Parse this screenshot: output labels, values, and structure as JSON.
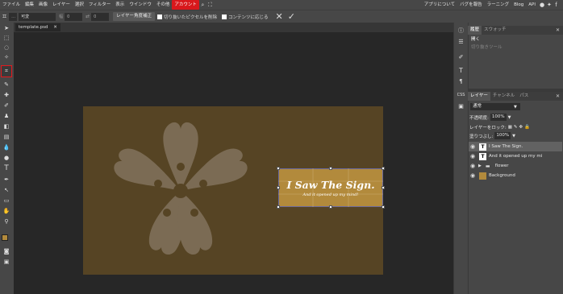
{
  "menu": {
    "items": [
      "ファイル",
      "編集",
      "画像",
      "レイヤー",
      "選択",
      "フィルター",
      "表示",
      "ウインドウ",
      "その他",
      "アカウント"
    ],
    "active": "アカウント",
    "right": [
      "アプリについて",
      "バグを報告",
      "ラーニング",
      "Blog",
      "API"
    ],
    "icons": [
      "search-icon",
      "fullscreen-icon",
      "reddit-icon",
      "twitter-icon",
      "facebook-icon"
    ]
  },
  "options": {
    "mode_value": "可変",
    "width_label": "幅",
    "width_value": "0",
    "height_value": "0",
    "layer_ratio_button": "レイヤー角度補正",
    "delete_cropped_label": "切り抜いたピクセルを削除",
    "fit_content_label": "コンテンツに応じる",
    "cancel_symbol": "✕",
    "confirm_symbol": "✓"
  },
  "document": {
    "tab_name": "template.psd",
    "tab_close": "✕",
    "title_text": "I Saw The Sign.",
    "subtitle_text": "And it opened up my mind!",
    "canvas_color": "#564424",
    "textbox_color": "#b28a3c"
  },
  "history_panel": {
    "tabs": [
      "履歴",
      "スウォッチ"
    ],
    "items": [
      "開く",
      "切り抜きツール"
    ]
  },
  "layers_panel": {
    "tabs": [
      "レイヤー",
      "チャンネル",
      "パス"
    ],
    "blend_mode": "通常",
    "opacity_label": "不透明度:",
    "opacity_value": "100%",
    "lock_label": "レイヤーをロック:",
    "fill_label": "塗りつぶし:",
    "fill_value": "100%",
    "layers": [
      {
        "name": "I Saw The Sign.",
        "kind": "text",
        "selected": true
      },
      {
        "name": "And it opened up my mi",
        "kind": "text",
        "selected": false
      },
      {
        "name": "flower",
        "kind": "folder",
        "selected": false
      },
      {
        "name": "Background",
        "kind": "image",
        "selected": false
      }
    ]
  },
  "colors": {
    "accent_red": "#d8181c",
    "foreground_swatch": "#b28a3c",
    "background_swatch": "#ffffff"
  }
}
